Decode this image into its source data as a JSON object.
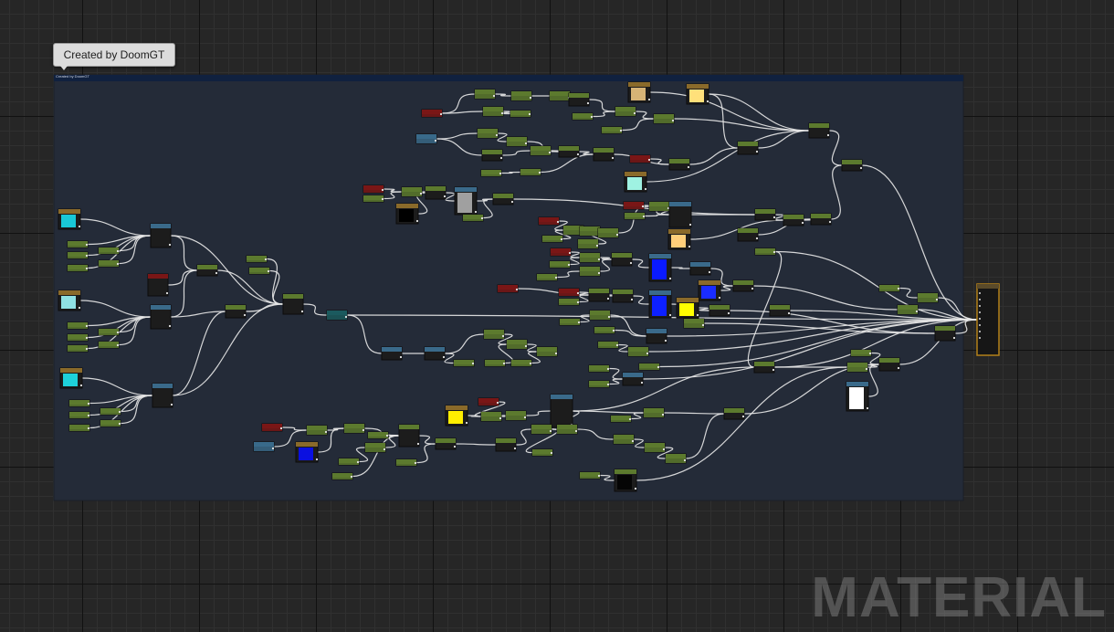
{
  "editor": {
    "comment_tooltip": "Created by DoomGT",
    "comment_title": "Created by DoomGT",
    "watermark": "MATERIAL"
  },
  "colors": {
    "canvas_background": "#262626",
    "comment_box": "#242b38",
    "comment_header": "#10213f",
    "wire": "#e6e6e6",
    "node_scalar": "#5c7a2e",
    "node_param_red": "#7a1616",
    "node_texture_blue": "#3a6a8a",
    "node_math": "#3d5e4a",
    "node_teal": "#1b5a5e",
    "node_constant_gold": "#8a6a2a",
    "main_output_border": "#b38019"
  },
  "swatches": [
    {
      "name": "cyan-1",
      "color": "#19c8d6"
    },
    {
      "name": "cyan-2",
      "color": "#8fe1e3"
    },
    {
      "name": "cyan-3",
      "color": "#1ed1da"
    },
    {
      "name": "tan",
      "color": "#d7b476"
    },
    {
      "name": "light-yellow",
      "color": "#ffe07a"
    },
    {
      "name": "mint",
      "color": "#9ff2e2"
    },
    {
      "name": "black",
      "color": "#000000"
    },
    {
      "name": "gray",
      "color": "#a0a0a0"
    },
    {
      "name": "peach",
      "color": "#ffcf7a"
    },
    {
      "name": "blue-1",
      "color": "#0a1aff"
    },
    {
      "name": "blue-2",
      "color": "#1a2cff"
    },
    {
      "name": "blue-3",
      "color": "#0d20ff"
    },
    {
      "name": "yellow-1",
      "color": "#ffff00"
    },
    {
      "name": "yellow-2",
      "color": "#ffee00"
    },
    {
      "name": "blue-4",
      "color": "#0a10e0"
    },
    {
      "name": "white",
      "color": "#ffffff"
    },
    {
      "name": "black-2",
      "color": "#050505"
    }
  ]
}
